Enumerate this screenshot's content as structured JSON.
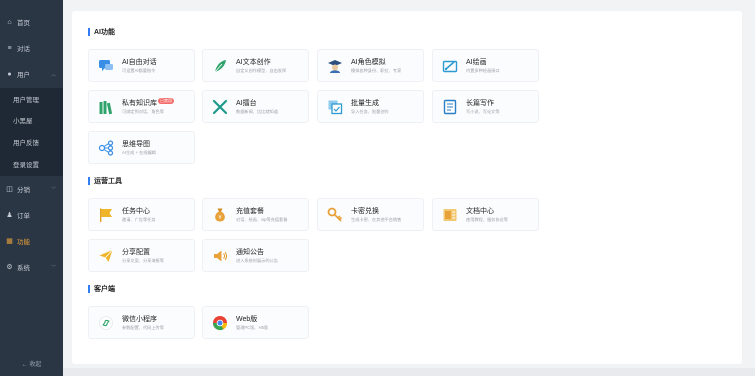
{
  "sidebar": {
    "items": [
      {
        "label": "首页",
        "icon": "home-icon"
      },
      {
        "label": "对话",
        "icon": "list-icon"
      },
      {
        "label": "用户",
        "icon": "user-icon"
      },
      {
        "label": "分销",
        "icon": "share-icon"
      },
      {
        "label": "订单",
        "icon": "bag-icon"
      },
      {
        "label": "功能",
        "icon": "grid-icon"
      },
      {
        "label": "系统",
        "icon": "gear-icon"
      }
    ],
    "submenu": [
      "用户管理",
      "小黑屋",
      "用户反馈",
      "登录设置"
    ],
    "collapse_label": "← 收起",
    "accent": "#e8a23a"
  },
  "sections": [
    {
      "title": "AI功能",
      "cards": [
        {
          "title": "AI自由对话",
          "desc": "可设置AI都要指令",
          "icon": "chat-icon",
          "color": "#3a8ee6"
        },
        {
          "title": "AI文本创作",
          "desc": "自定义创作模型、自由发挥",
          "icon": "feather-icon",
          "color": "#2fa36b"
        },
        {
          "title": "AI角色模拟",
          "desc": "模拟各种身份、职位、专家",
          "icon": "graduate-icon",
          "color": "#3a6fb0"
        },
        {
          "title": "AI绘画",
          "desc": "内置多种绘画接口",
          "icon": "paint-icon",
          "color": "#2d9ad1"
        },
        {
          "title": "私有知识库",
          "desc": "可绑定到对话、角色等",
          "icon": "books-icon",
          "color": "#2fa36b",
          "badge": "已禁用"
        },
        {
          "title": "AI擂台",
          "desc": "数据新闻、比比就知道",
          "icon": "swords-icon",
          "color": "#1f9a8a"
        },
        {
          "title": "批量生成",
          "desc": "导入任务、批量创作",
          "icon": "batch-icon",
          "color": "#2d9ad1"
        },
        {
          "title": "长篇写作",
          "desc": "写小说、写论文等",
          "icon": "document-icon",
          "color": "#2b7fc7"
        },
        {
          "title": "思维导图",
          "desc": "AI生成 + 在线编辑",
          "icon": "mindmap-icon",
          "color": "#3a8ee6"
        }
      ]
    },
    {
      "title": "运营工具",
      "cards": [
        {
          "title": "任务中心",
          "desc": "邀请、广告等任务",
          "icon": "flag-icon",
          "color": "#f0b429"
        },
        {
          "title": "充值套餐",
          "desc": "对话、绘画、vip等充值套餐",
          "icon": "moneybag-icon",
          "color": "#e8a23a"
        },
        {
          "title": "卡密兑换",
          "desc": "生成卡密、在其他平台销售",
          "icon": "key-icon",
          "color": "#e8a23a"
        },
        {
          "title": "文档中心",
          "desc": "使用教程、服务协议等",
          "icon": "doc-center-icon",
          "color": "#e8a23a"
        },
        {
          "title": "分享配置",
          "desc": "分享文案、分享海报等",
          "icon": "send-icon",
          "color": "#e8a23a"
        },
        {
          "title": "通知公告",
          "desc": "进入系统时展示的公告",
          "icon": "speaker-icon",
          "color": "#e8a23a"
        }
      ]
    },
    {
      "title": "客户端",
      "cards": [
        {
          "title": "微信小程序",
          "desc": "参数配置、代码上传等",
          "icon": "miniprogram-icon",
          "color": "#2fa36b"
        },
        {
          "title": "Web版",
          "desc": "管理PC版、H5版",
          "icon": "chrome-icon",
          "color": "#e94235"
        }
      ]
    }
  ]
}
